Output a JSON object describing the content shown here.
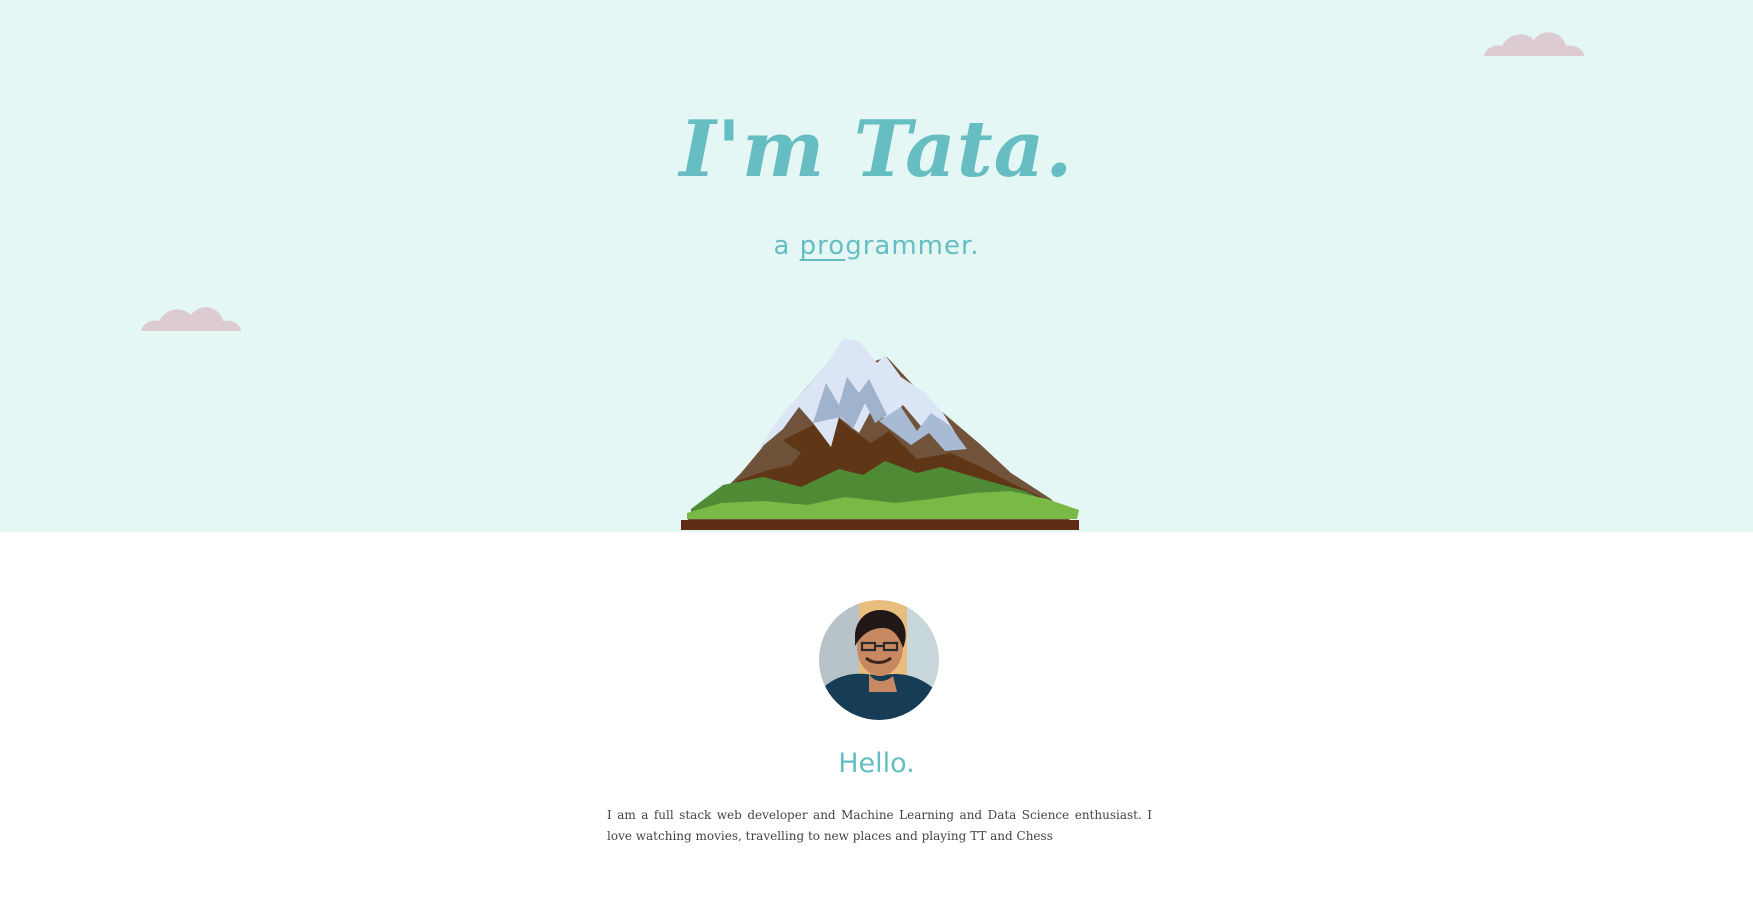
{
  "hero": {
    "title": "I'm Tata.",
    "subtitle_prefix": "a ",
    "subtitle_typed": "pro",
    "subtitle_rest": "grammer.",
    "background_color": "#e4f7f4",
    "accent_color": "#66bdc2"
  },
  "about": {
    "heading": "Hello.",
    "text": "I am a full stack web developer and Machine Learning and Data Science enthusiast. I love watching movies, travelling to new places and playing TT and Chess"
  },
  "icons": {
    "cloud": "cloud-icon",
    "mountain": "mountain-illustration",
    "avatar": "profile-photo"
  }
}
